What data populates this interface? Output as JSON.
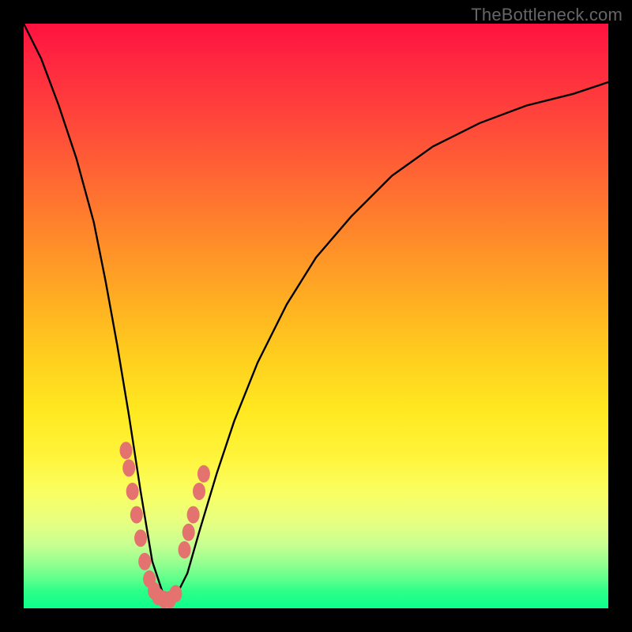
{
  "watermark": "TheBottleneck.com",
  "colors": {
    "frame": "#000000",
    "curve_stroke": "#000000",
    "marker_fill": "#e4736f",
    "gradient_top": "#ff123f",
    "gradient_bottom": "#0cff8c"
  },
  "chart_data": {
    "type": "line",
    "title": "",
    "xlabel": "",
    "ylabel": "",
    "xlim": [
      0,
      100
    ],
    "ylim": [
      0,
      100
    ],
    "notes": "V-shaped bottleneck curve over a red-to-green vertical gradient backdrop. x is a parameter (approx 0–100), y is bottleneck severity (100 = red/worst at top, 0 = green/best at bottom). Minimum of the curve is near x≈22–25. The left branch falls steeply from top-left; the right branch rises asymptotically toward the top-right.",
    "series": [
      {
        "name": "bottleneck-curve",
        "x": [
          0,
          3,
          6,
          9,
          12,
          14,
          16,
          18,
          20,
          22,
          24,
          26,
          28,
          30,
          33,
          36,
          40,
          45,
          50,
          56,
          63,
          70,
          78,
          86,
          94,
          100
        ],
        "y": [
          100,
          94,
          86,
          77,
          66,
          56,
          45,
          33,
          20,
          8,
          2,
          2,
          6,
          13,
          23,
          32,
          42,
          52,
          60,
          67,
          74,
          79,
          83,
          86,
          88,
          90
        ]
      }
    ],
    "markers": {
      "name": "highlighted-points",
      "color": "#e4736f",
      "left_cluster": {
        "x": [
          17.5,
          18.0,
          18.6,
          19.3,
          20.0,
          20.7,
          21.5,
          22.3
        ],
        "y": [
          27,
          24,
          20,
          16,
          12,
          8,
          5,
          3
        ]
      },
      "right_cluster": {
        "x": [
          27.5,
          28.2,
          29.0,
          30.0,
          30.8
        ],
        "y": [
          10,
          13,
          16,
          20,
          23
        ]
      },
      "bottom_cluster": {
        "x": [
          23.0,
          24.0,
          25.0,
          26.0
        ],
        "y": [
          2,
          1.5,
          1.5,
          2.5
        ]
      }
    }
  }
}
